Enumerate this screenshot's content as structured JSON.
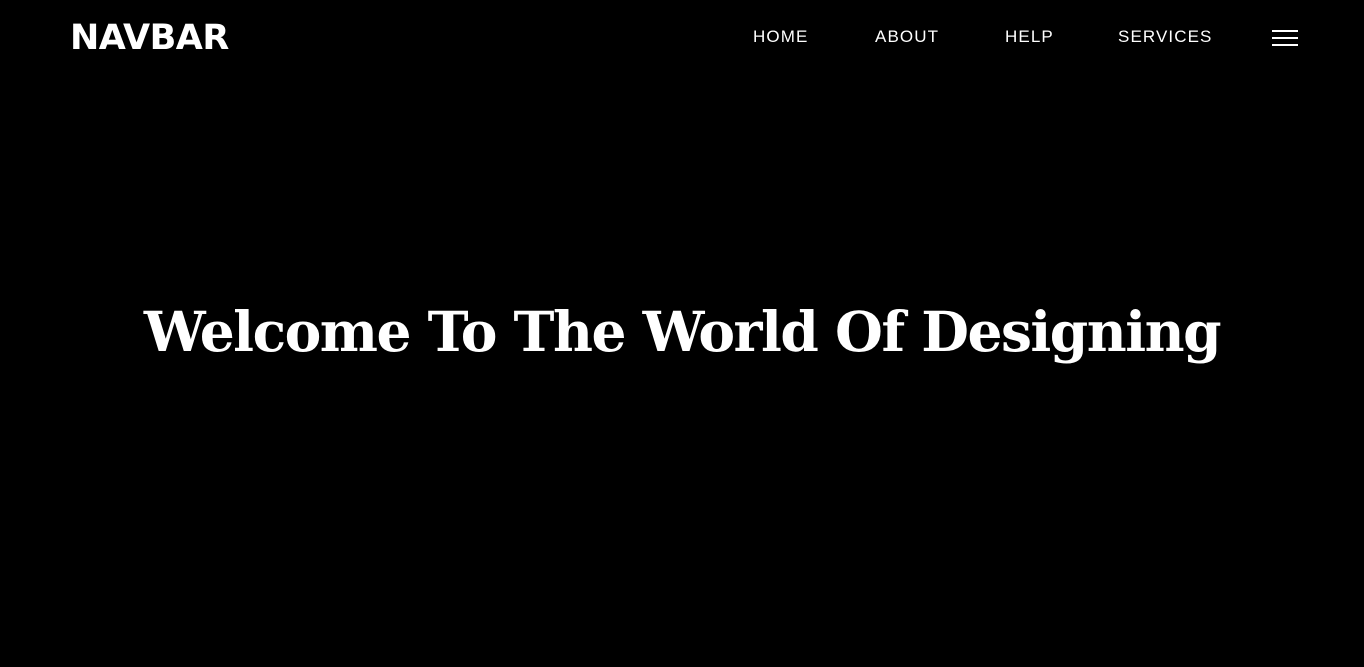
{
  "navbar": {
    "brand": "NAVBAR",
    "links": [
      {
        "label": "HOME"
      },
      {
        "label": "ABOUT"
      },
      {
        "label": "HELP"
      },
      {
        "label": "SERVICES"
      }
    ],
    "menu_icon": "hamburger-menu-icon"
  },
  "hero": {
    "title": "Welcome To The World Of Designing"
  },
  "colors": {
    "background": "#000000",
    "text": "#ffffff"
  }
}
